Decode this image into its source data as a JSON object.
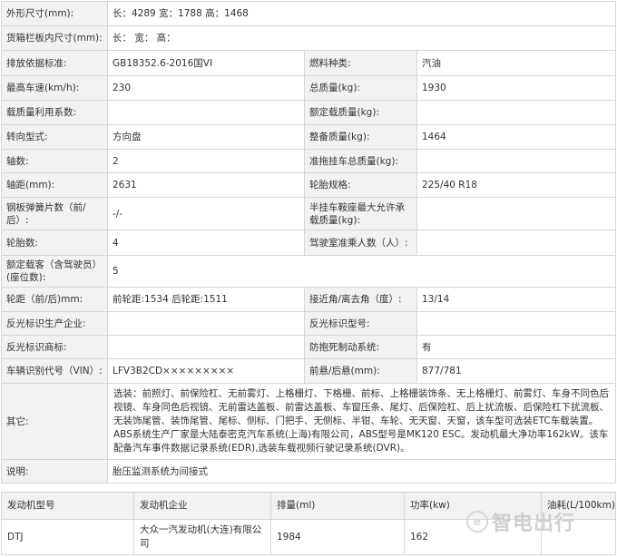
{
  "specs": {
    "rows": [
      {
        "l1": "外形尺寸(mm):",
        "v1": "长：4289 宽：1788 高：1468"
      },
      {
        "l1": "货箱栏板内尺寸(mm):",
        "v1": "长：  宽：  高："
      },
      {
        "l1": "排放依据标准:",
        "v1": "GB18352.6-2016国VI",
        "l2": "燃料种类:",
        "v2": "汽油"
      },
      {
        "l1": "最高车速(km/h):",
        "v1": "230",
        "l2": "总质量(kg):",
        "v2": "1930"
      },
      {
        "l1": "载质量利用系数:",
        "v1": "",
        "l2": "额定载质量(kg):",
        "v2": ""
      },
      {
        "l1": "转向型式:",
        "v1": "方向盘",
        "l2": "整备质量(kg):",
        "v2": "1464"
      },
      {
        "l1": "轴数:",
        "v1": "2",
        "l2": "准拖挂车总质量(kg):",
        "v2": ""
      },
      {
        "l1": "轴距(mm):",
        "v1": "2631",
        "l2": "轮胎规格:",
        "v2": "225/40 R18"
      },
      {
        "l1": "钢板弹簧片数（前/后）:",
        "v1": "-/-",
        "l2": "半挂车鞍座最大允许承载质量(kg):",
        "v2": ""
      },
      {
        "l1": "轮胎数:",
        "v1": "4",
        "l2": "驾驶室准乘人数（人）:",
        "v2": ""
      },
      {
        "l1": "额定载客（含驾驶员）(座位数):",
        "v1": "5"
      },
      {
        "l1": "轮距（前/后)mm:",
        "v1": "前轮距:1534 后轮距:1511",
        "l2": "接近角/离去角（度）:",
        "v2": "13/14"
      },
      {
        "l1": "反光标识生产企业:",
        "v1": "",
        "l2": "反光标识型号:",
        "v2": ""
      },
      {
        "l1": "反光标识商标:",
        "v1": "",
        "l2": "防抱死制动系统:",
        "v2": "有"
      },
      {
        "l1": "车辆识别代号（VIN）:",
        "v1": "LFV3B2CD×××××××××",
        "l2": "前悬/后悬(mm):",
        "v2": "877/781"
      }
    ],
    "other_label": "其它:",
    "other_value": "选装：前照灯、前保险杠、无前雾灯、上格栅灯、下格栅、前标、上格栅装饰条、无上格栅灯、前雾灯、车身不同色后视镜、车身同色后视镜、无前雷达盖板、前雷达盖板、车窗压条、尾灯、后保险杠、后上扰流板、后保险杠下扰流板、无装饰尾管、装饰尾管、尾标、侧标、门把手、无侧标、半钳、车轮、无天窗、天窗，该车型可选装ETC车载装置。ABS系统生产厂家是大陆泰密克汽车系统(上海)有限公司，ABS型号是MK120 ESC。发动机最大净功率162kW。该车配备汽车事件数据记录系统(EDR),选装车载视频行驶记录系统(DVR)。",
    "note_label": "说明:",
    "note_value": "胎压监测系统为间接式"
  },
  "engine_table": {
    "headers": [
      "发动机型号",
      "发动机企业",
      "排量(ml)",
      "功率(kw)",
      "油耗(L/100km)"
    ],
    "row": [
      "DTJ",
      "大众一汽发动机(大连)有限公司",
      "1984",
      "162",
      ""
    ]
  },
  "watermark": {
    "text": "智电出行",
    "logo_glyph": "e"
  }
}
